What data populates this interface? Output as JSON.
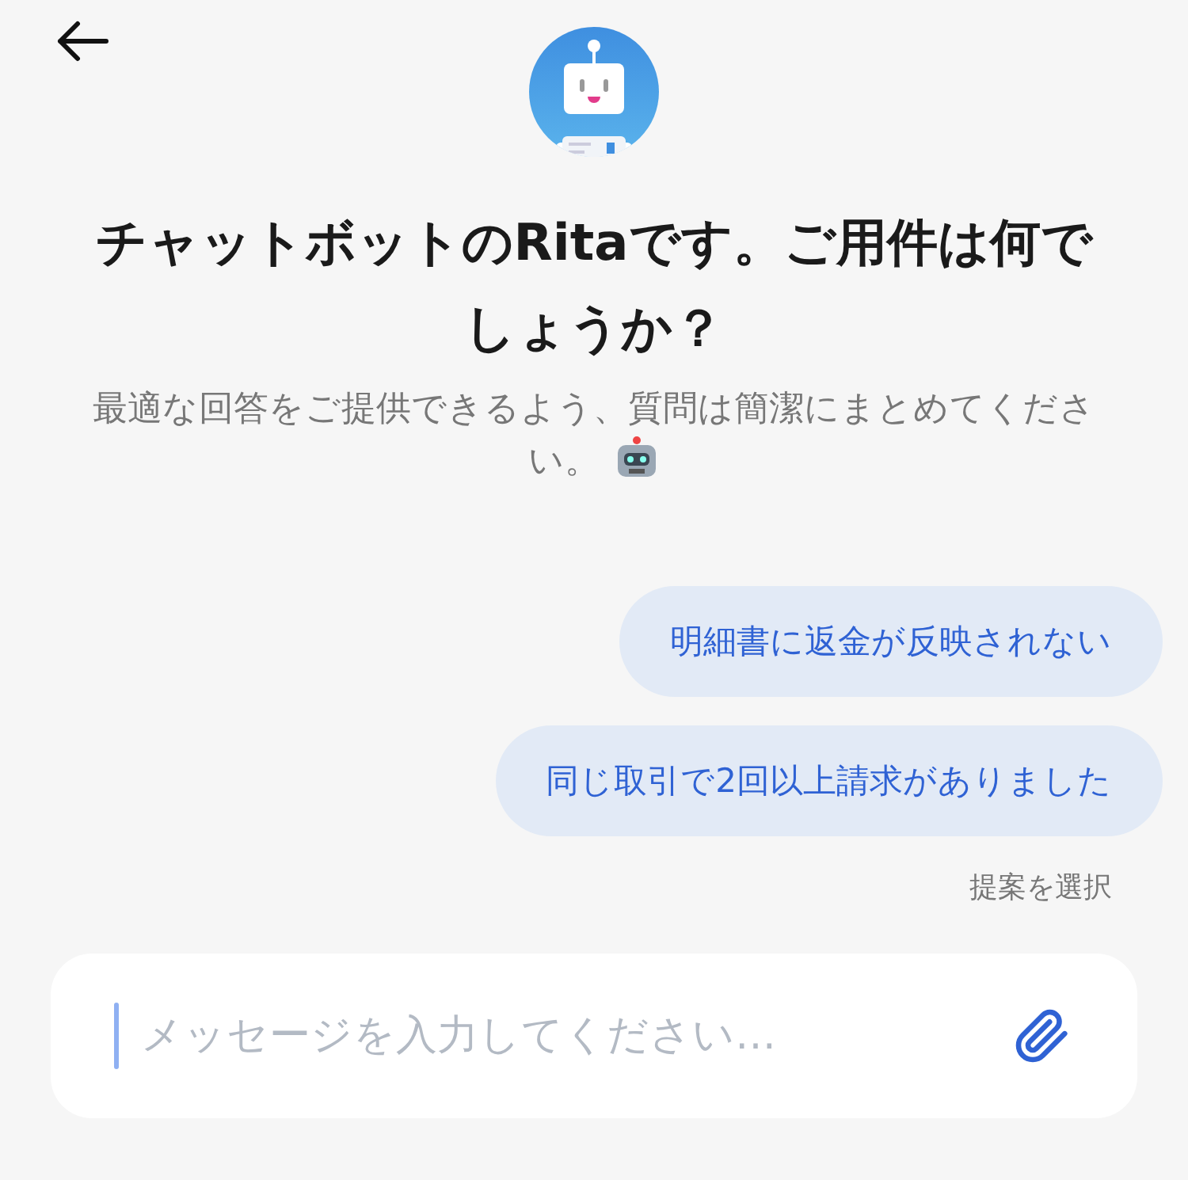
{
  "header": {
    "title": "チャットボットのRitaです。ご用件は何でしょうか？",
    "subtitle": "最適な回答をご提供できるよう、質問は簡潔にまとめてください。"
  },
  "suggestions": [
    {
      "label": "明細書に返金が反映されない"
    },
    {
      "label": "同じ取引で2回以上請求がありました"
    }
  ],
  "suggestions_hint": "提案を選択",
  "composer": {
    "placeholder": "メッセージを入力してください…"
  }
}
